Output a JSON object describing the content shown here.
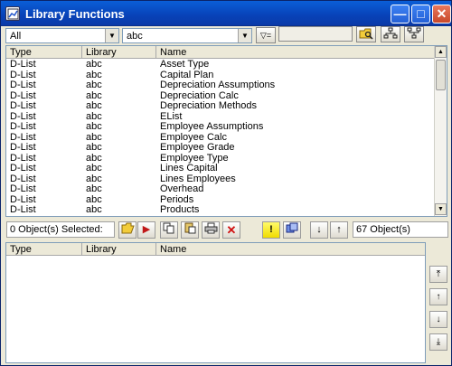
{
  "window": {
    "title": "Library Functions",
    "minimize_glyph": "—",
    "maximize_glyph": "□",
    "close_glyph": "✕"
  },
  "toolbar": {
    "type_filter_value": "All",
    "library_filter_value": "abc",
    "filter_button_glyph": "▽="
  },
  "top_grid": {
    "columns": [
      "Type",
      "Library",
      "Name"
    ],
    "rows": [
      {
        "type": "D-List",
        "library": "abc",
        "name": "Asset Type"
      },
      {
        "type": "D-List",
        "library": "abc",
        "name": "Capital Plan"
      },
      {
        "type": "D-List",
        "library": "abc",
        "name": "Depreciation Assumptions"
      },
      {
        "type": "D-List",
        "library": "abc",
        "name": "Depreciation Calc"
      },
      {
        "type": "D-List",
        "library": "abc",
        "name": "Depreciation Methods"
      },
      {
        "type": "D-List",
        "library": "abc",
        "name": "EList"
      },
      {
        "type": "D-List",
        "library": "abc",
        "name": "Employee Assumptions"
      },
      {
        "type": "D-List",
        "library": "abc",
        "name": "Employee Calc"
      },
      {
        "type": "D-List",
        "library": "abc",
        "name": "Employee Grade"
      },
      {
        "type": "D-List",
        "library": "abc",
        "name": "Employee Type"
      },
      {
        "type": "D-List",
        "library": "abc",
        "name": "Lines Capital"
      },
      {
        "type": "D-List",
        "library": "abc",
        "name": "Lines Employees"
      },
      {
        "type": "D-List",
        "library": "abc",
        "name": "Overhead"
      },
      {
        "type": "D-List",
        "library": "abc",
        "name": "Periods"
      },
      {
        "type": "D-List",
        "library": "abc",
        "name": "Products"
      }
    ]
  },
  "status": {
    "selected_text": "0 Object(s) Selected:",
    "count_text": "67 Object(s)"
  },
  "bottom_grid": {
    "columns": [
      "Type",
      "Library",
      "Name"
    ]
  },
  "colors": {
    "titlebar": "#0a4bc8",
    "window_face": "#ece9d8",
    "delete_red": "#d01010",
    "play_red": "#c01818",
    "highlight_yellow": "#f8e800"
  }
}
